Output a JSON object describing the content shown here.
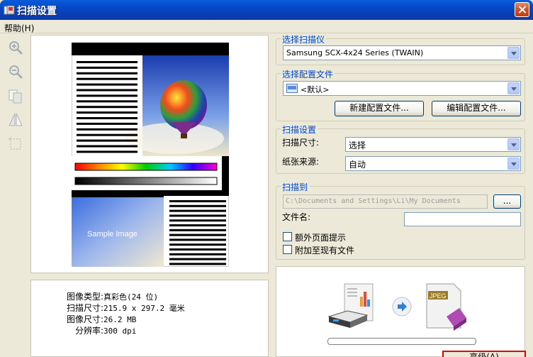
{
  "window": {
    "title": "扫描设置"
  },
  "menu": {
    "help": "帮助(H)"
  },
  "info": {
    "image_type_label": "图像类型:",
    "image_type_value": "真彩色(24 位)",
    "scan_size_label": "扫描尺寸:",
    "scan_size_value": "215.9 x 297.2 毫米",
    "image_size_label": "图像尺寸:",
    "image_size_value": "26.2 MB",
    "resolution_label": "分辨率:",
    "resolution_value": "300 dpi"
  },
  "preview": {
    "sample_text": "Sample Image"
  },
  "scanner_group": {
    "title": "选择扫描仪",
    "selected": "Samsung SCX-4x24 Series (TWAIN)"
  },
  "profile_group": {
    "title": "选择配置文件",
    "selected": "<默认>",
    "new_button": "新建配置文件...",
    "edit_button": "编辑配置文件..."
  },
  "scan_settings": {
    "title": "扫描设置",
    "size_label": "扫描尺寸:",
    "size_value": "选择",
    "source_label": "纸张来源:",
    "source_value": "自动"
  },
  "scan_to": {
    "title": "扫描到",
    "path": "C:\\Documents and Settings\\Li\\My Documents",
    "browse_button": "...",
    "filename_label": "文件名:",
    "filename_value": "",
    "extra_page_label": "额外页面提示",
    "append_label": "附加至现有文件"
  },
  "animation": {
    "format_label": "JPEG"
  },
  "footer": {
    "advanced_button": "高级(A)"
  }
}
